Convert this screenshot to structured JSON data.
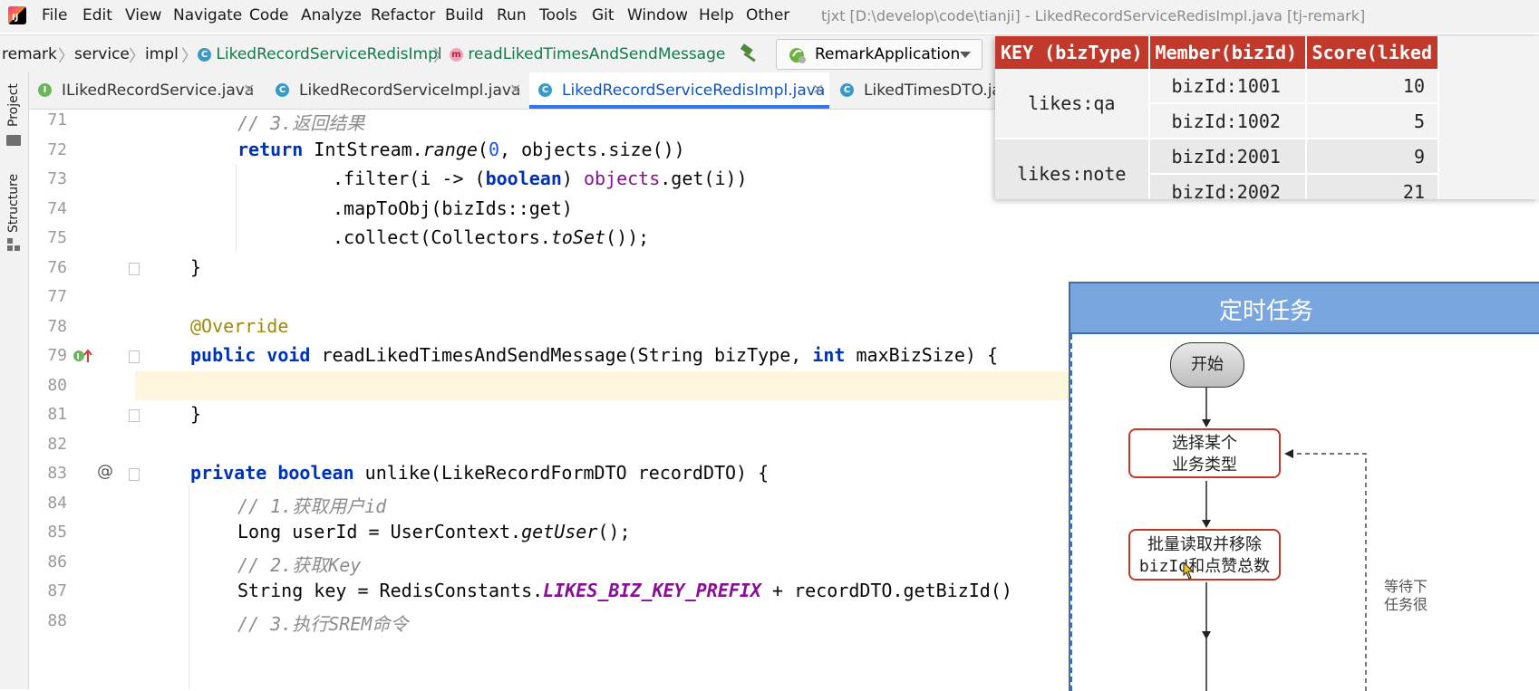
{
  "menubar": {
    "items": [
      "File",
      "Edit",
      "View",
      "Navigate",
      "Code",
      "Analyze",
      "Refactor",
      "Build",
      "Run",
      "Tools",
      "Git",
      "Window",
      "Help",
      "Other"
    ],
    "window_title": "tjxt [D:\\develop\\code\\tianji] - LikedRecordServiceRedisImpl.java [tj-remark]"
  },
  "breadcrumb": {
    "items": [
      "remark",
      "service",
      "impl",
      "LikedRecordServiceRedisImpl",
      "readLikedTimesAndSendMessage"
    ]
  },
  "run_config": {
    "label": "RemarkApplication"
  },
  "tabs": [
    {
      "label": "ILikedRecordService.java",
      "badge": "I",
      "active": false
    },
    {
      "label": "LikedRecordServiceImpl.java",
      "badge": "C",
      "active": false
    },
    {
      "label": "LikedRecordServiceRedisImpl.java",
      "badge": "C",
      "active": true
    },
    {
      "label": "LikedTimesDTO.jav",
      "badge": "C",
      "active": false
    }
  ],
  "toolwindows": {
    "project": "Project",
    "structure": "Structure"
  },
  "editor": {
    "current_line": 80,
    "lines": [
      {
        "n": "71",
        "text": "// 3.返回结果"
      },
      {
        "n": "72",
        "text": "return IntStream.range(0, objects.size())"
      },
      {
        "n": "73",
        "text": ".filter(i -> (boolean) objects.get(i))"
      },
      {
        "n": "74",
        "text": ".mapToObj(bizIds::get)"
      },
      {
        "n": "75",
        "text": ".collect(Collectors.toSet());"
      },
      {
        "n": "76",
        "text": "}"
      },
      {
        "n": "77",
        "text": ""
      },
      {
        "n": "78",
        "text": "@Override"
      },
      {
        "n": "79",
        "text": "public void readLikedTimesAndSendMessage(String bizType, int maxBizSize) {"
      },
      {
        "n": "80",
        "text": ""
      },
      {
        "n": "81",
        "text": "}"
      },
      {
        "n": "82",
        "text": ""
      },
      {
        "n": "83",
        "text": "private boolean unlike(LikeRecordFormDTO recordDTO) {"
      },
      {
        "n": "84",
        "text": "// 1.获取用户id"
      },
      {
        "n": "85",
        "text": "Long userId = UserContext.getUser();"
      },
      {
        "n": "86",
        "text": "// 2.获取Key"
      },
      {
        "n": "87",
        "text": "String key = RedisConstants.LIKES_BIZ_KEY_PREFIX + recordDTO.getBizId()"
      },
      {
        "n": "88",
        "text": "// 3.执行SREM命令"
      }
    ]
  },
  "redis_table": {
    "headers": [
      "KEY (bizType)",
      "Member(bizId)",
      "Score(liked"
    ],
    "groups": [
      {
        "key": "likes:qa",
        "rows": [
          {
            "member": "bizId:1001",
            "score": "10"
          },
          {
            "member": "bizId:1002",
            "score": "5"
          }
        ]
      },
      {
        "key": "likes:note",
        "rows": [
          {
            "member": "bizId:2001",
            "score": "9"
          },
          {
            "member": "bizId:2002",
            "score": "21"
          }
        ]
      }
    ]
  },
  "flowchart": {
    "title": "定时任务",
    "start": "开始",
    "step1": [
      "选择某个",
      "业务类型"
    ],
    "step2": [
      "批量读取并移除",
      "bizId和点赞总数"
    ],
    "side_note": [
      "等待下",
      "任务很"
    ]
  },
  "colors": {
    "keyword": "#0033b3",
    "comment": "#8c8c8c",
    "annotation": "#9e880d",
    "table_header": "#c0392b",
    "flow_header": "#7aa6df",
    "active_tab_underline": "#3574f0"
  }
}
